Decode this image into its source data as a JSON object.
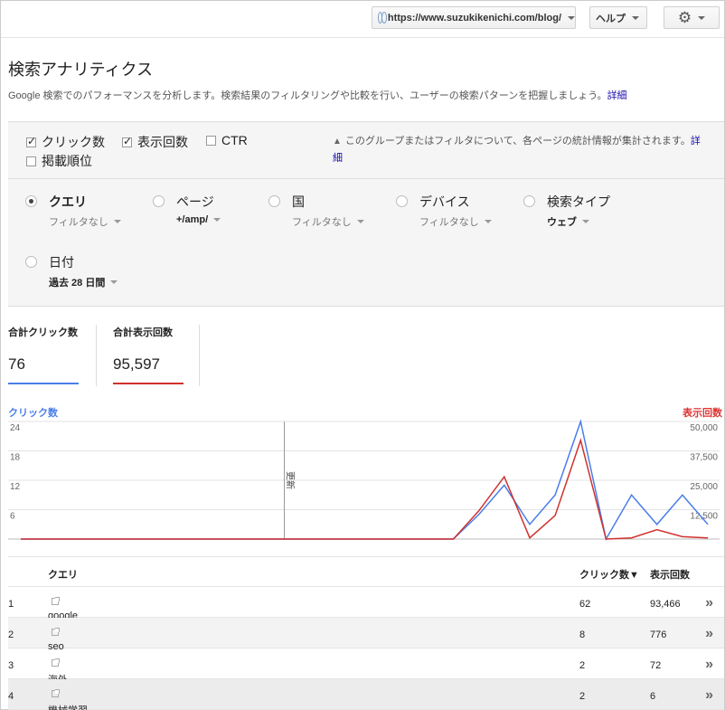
{
  "header": {
    "site_url": "https://www.suzukikenichi.com/blog/",
    "help_label": "ヘルプ",
    "settings_icon": "gear-icon"
  },
  "page": {
    "title": "検索アナリティクス",
    "description": "Google 検索でのパフォーマンスを分析します。検索結果のフィルタリングや比較を行い、ユーザーの検索パターンを把握しましょう。",
    "details_link": "詳細"
  },
  "metrics": [
    {
      "label": "クリック数",
      "checked": true
    },
    {
      "label": "表示回数",
      "checked": true
    },
    {
      "label": "CTR",
      "checked": false
    },
    {
      "label": "掲載順位",
      "checked": false
    }
  ],
  "note": {
    "text": "このグループまたはフィルタについて、各ページの統計情報が集計されます。",
    "link": "詳細"
  },
  "dimensions": [
    {
      "label": "クエリ",
      "value": "フィルタなし",
      "selected": true,
      "value_bold": false
    },
    {
      "label": "ページ",
      "value": "+/amp/",
      "selected": false,
      "value_bold": true
    },
    {
      "label": "国",
      "value": "フィルタなし",
      "selected": false,
      "value_bold": false
    },
    {
      "label": "デバイス",
      "value": "フィルタなし",
      "selected": false,
      "value_bold": false
    },
    {
      "label": "検索タイプ",
      "value": "ウェブ",
      "selected": false,
      "value_bold": true
    },
    {
      "label": "日付",
      "value": "過去 28 日間",
      "selected": false,
      "value_bold": true
    }
  ],
  "totals": {
    "clicks_label": "合計クリック数",
    "clicks_value": "76",
    "impressions_label": "合計表示回数",
    "impressions_value": "95,597"
  },
  "chart_data": {
    "type": "line",
    "left_axis_label": "クリック数",
    "right_axis_label": "表示回数",
    "left_ticks": [
      "24",
      "18",
      "12",
      "6"
    ],
    "right_ticks": [
      "50,000",
      "37,500",
      "25,000",
      "12,500"
    ],
    "left_ylim": [
      0,
      24
    ],
    "right_ylim": [
      0,
      50000
    ],
    "annotation": "更新",
    "annotation_index": 10,
    "colors": {
      "clicks": "#4a7ee8",
      "impressions": "#d0312d"
    },
    "series": [
      {
        "name": "クリック数",
        "axis": "left",
        "values": [
          0,
          0,
          0,
          0,
          0,
          0,
          0,
          0,
          0,
          0,
          0,
          0,
          0,
          0,
          0,
          0,
          0,
          0,
          5,
          11,
          3,
          9,
          24,
          0,
          9,
          3,
          9,
          3
        ]
      },
      {
        "name": "表示回数",
        "axis": "right",
        "values": [
          0,
          0,
          0,
          0,
          0,
          0,
          0,
          0,
          0,
          0,
          0,
          0,
          0,
          0,
          0,
          0,
          0,
          0,
          12000,
          26500,
          500,
          10000,
          42000,
          0,
          500,
          4000,
          1000,
          500
        ]
      }
    ]
  },
  "table": {
    "headers": {
      "index": "",
      "query": "クエリ",
      "clicks": "クリック数▼",
      "impressions": "表示回数"
    },
    "rows": [
      {
        "index": "1",
        "query": "google",
        "clicks": "62",
        "impressions": "93,466"
      },
      {
        "index": "2",
        "query": "seo",
        "clicks": "8",
        "impressions": "776"
      },
      {
        "index": "3",
        "query": "海外",
        "clicks": "2",
        "impressions": "72"
      },
      {
        "index": "4",
        "query": "機械学習",
        "clicks": "2",
        "impressions": "6"
      }
    ],
    "row_action_icon": "double-chevron-right-icon"
  }
}
